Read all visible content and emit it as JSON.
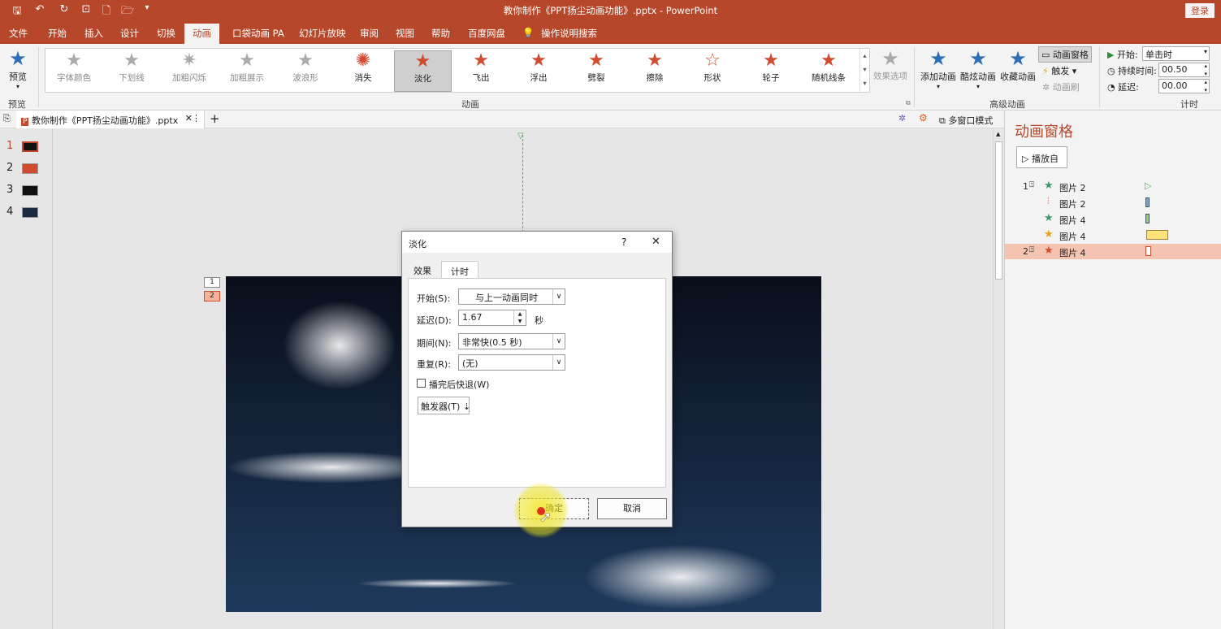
{
  "title_bar": {
    "title": "教你制作《PPT扬尘动画功能》.pptx - PowerPoint",
    "login": "登录"
  },
  "tabs": [
    "文件",
    "开始",
    "插入",
    "设计",
    "切换",
    "动画",
    "口袋动画 PA",
    "幻灯片放映",
    "审阅",
    "视图",
    "帮助",
    "百度网盘",
    "操作说明搜索"
  ],
  "ribbon": {
    "preview_label": "预览",
    "preview_group": "预览",
    "animation_group": "动画",
    "advanced_group": "高级动画",
    "timing_group": "计时",
    "animations": [
      "字体颜色",
      "下划线",
      "加粗闪烁",
      "加粗展示",
      "波浪形",
      "消失",
      "淡化",
      "飞出",
      "浮出",
      "劈裂",
      "擦除",
      "形状",
      "轮子",
      "随机线条"
    ],
    "effect_options": "效果选项",
    "add_animation": "添加动画",
    "cool_animation": "酷炫动画",
    "collect_animation": "收藏动画",
    "anim_pane_btn": "动画窗格",
    "trigger": "触发",
    "anim_painter": "动画刷",
    "start_label": "开始:",
    "start_value": "单击时",
    "duration_label": "持续时间:",
    "duration_value": "00.50",
    "delay_label": "延迟:",
    "delay_value": "00.00"
  },
  "doc_tab": {
    "name": "教你制作《PPT扬尘动画功能》.pptx",
    "multiwindow": "多窗口模式"
  },
  "thumbnails": [
    "1",
    "2",
    "3",
    "4"
  ],
  "slide_markers": [
    "1",
    "2"
  ],
  "pane": {
    "title": "动画窗格",
    "play_button": "播放自",
    "rows": [
      {
        "num": "1",
        "name": "图片 2"
      },
      {
        "num": "",
        "name": "图片 2"
      },
      {
        "num": "",
        "name": "图片 4"
      },
      {
        "num": "",
        "name": "图片 4"
      },
      {
        "num": "2",
        "name": "图片 4"
      }
    ]
  },
  "dialog": {
    "title": "淡化",
    "help": "?",
    "close": "✕",
    "tab_effect": "效果",
    "tab_timing": "计时",
    "start_label": "开始(S):",
    "start_value": "与上一动画同时",
    "delay_label": "延迟(D):",
    "delay_value": "1.67",
    "delay_unit": "秒",
    "period_label": "期间(N):",
    "period_value": "非常快(0.5 秒)",
    "repeat_label": "重复(R):",
    "repeat_value": "(无)",
    "rewind_label": "播完后快退(W)",
    "trigger_btn": "触发器(T)",
    "ok": "确定",
    "cancel": "取消"
  },
  "colors": {
    "accent": "#b7472a",
    "ribbon_bg": "#f3f3f3",
    "anim_star": "#d04b2f"
  }
}
